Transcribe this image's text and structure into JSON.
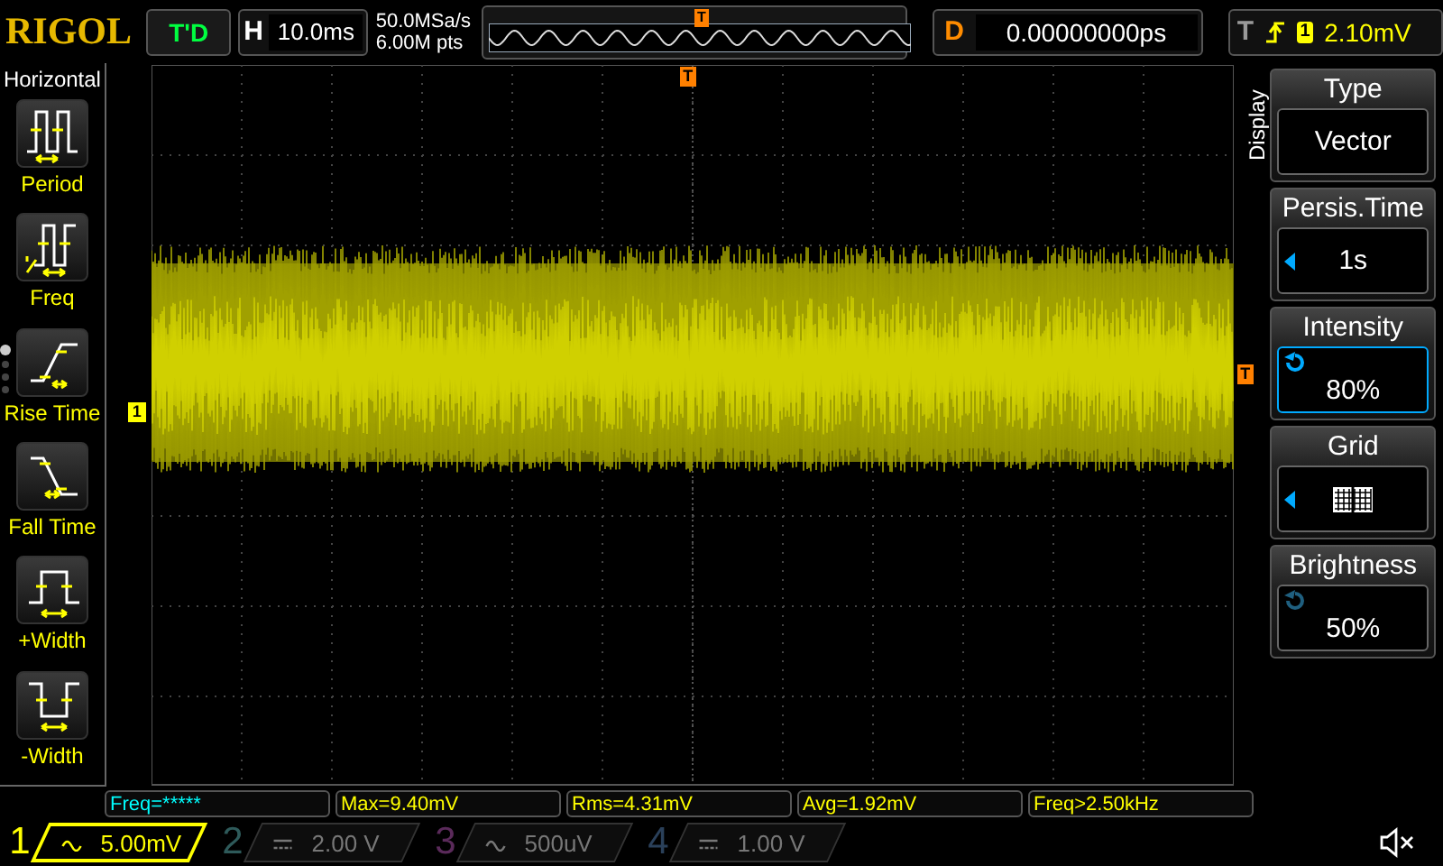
{
  "logo": "RIGOL",
  "run_status": "T'D",
  "timebase": {
    "label": "H",
    "value": "10.0ms"
  },
  "acquisition": {
    "sample_rate": "50.0MSa/s",
    "memory_depth": "6.00M pts"
  },
  "overview": {
    "trigger_mark": "T"
  },
  "delay": {
    "label": "D",
    "value": "0.00000000ps"
  },
  "trigger": {
    "label": "T",
    "rising_edge": true,
    "channel": "1",
    "level": "2.10mV"
  },
  "left_menu": {
    "title": "Horizontal",
    "items": [
      {
        "kind": "period",
        "label": "Period"
      },
      {
        "kind": "freq",
        "label": "Freq"
      },
      {
        "kind": "rise",
        "label": "Rise Time"
      },
      {
        "kind": "fall",
        "label": "Fall Time"
      },
      {
        "kind": "pwidth",
        "label": "+Width"
      },
      {
        "kind": "nwidth",
        "label": "-Width"
      }
    ],
    "pages": [
      {
        "selected": true
      },
      {
        "selected": false
      },
      {
        "selected": false
      },
      {
        "selected": false
      }
    ]
  },
  "screen": {
    "channel_marker": "1",
    "trigger_position_marker": "T",
    "trigger_level_marker": "T"
  },
  "right_menu": {
    "title": "Display",
    "items": [
      {
        "kind": "value",
        "label": "Type",
        "value": "Vector",
        "selected": false
      },
      {
        "kind": "arrow",
        "label": "Persis.Time",
        "value": "1s",
        "selected": false
      },
      {
        "kind": "knob",
        "label": "Intensity",
        "value": "80%",
        "selected": true
      },
      {
        "kind": "grid",
        "label": "Grid",
        "selected": false
      },
      {
        "kind": "knob",
        "label": "Brightness",
        "value": "50%",
        "selected": false
      }
    ]
  },
  "measurements": [
    {
      "text": "Freq=*****",
      "color": "#00ffff"
    },
    {
      "text": "Max=9.40mV",
      "color": "#ffff00"
    },
    {
      "text": "Rms=4.31mV",
      "color": "#ffff00"
    },
    {
      "text": "Avg=1.92mV",
      "color": "#ffff00"
    },
    {
      "text": "Freq>2.50kHz",
      "color": "#ffff00"
    }
  ],
  "channels": [
    {
      "number": "1",
      "kind": "ac",
      "scale": "5.00mV",
      "on": true,
      "color": "#ffff00"
    },
    {
      "number": "2",
      "kind": "dc",
      "scale": "2.00 V",
      "on": false,
      "color": "#2e5a5a"
    },
    {
      "number": "3",
      "kind": "ac",
      "scale": "500uV",
      "on": false,
      "color": "#5a2a5a"
    },
    {
      "number": "4",
      "kind": "dc",
      "scale": "1.00 V",
      "on": false,
      "color": "#2a405a"
    }
  ],
  "sound": {
    "muted": true
  }
}
